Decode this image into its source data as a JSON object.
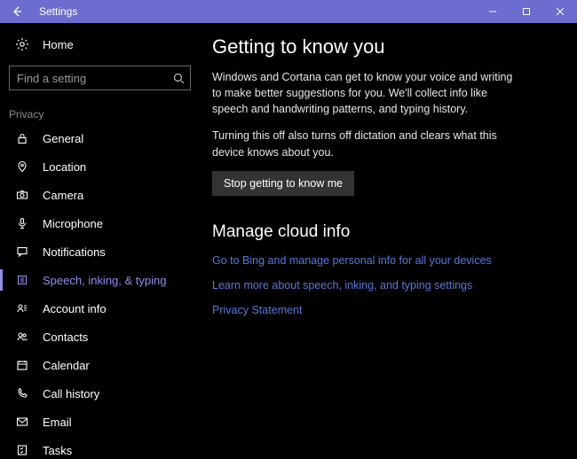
{
  "titlebar": {
    "title": "Settings"
  },
  "sidebar": {
    "home_label": "Home",
    "search_placeholder": "Find a setting",
    "section_label": "Privacy",
    "items": [
      {
        "label": "General",
        "icon": "lock-icon",
        "active": false
      },
      {
        "label": "Location",
        "icon": "location-icon",
        "active": false
      },
      {
        "label": "Camera",
        "icon": "camera-icon",
        "active": false
      },
      {
        "label": "Microphone",
        "icon": "microphone-icon",
        "active": false
      },
      {
        "label": "Notifications",
        "icon": "notifications-icon",
        "active": false
      },
      {
        "label": "Speech, inking, & typing",
        "icon": "speech-icon",
        "active": true
      },
      {
        "label": "Account info",
        "icon": "account-info-icon",
        "active": false
      },
      {
        "label": "Contacts",
        "icon": "contacts-icon",
        "active": false
      },
      {
        "label": "Calendar",
        "icon": "calendar-icon",
        "active": false
      },
      {
        "label": "Call history",
        "icon": "call-history-icon",
        "active": false
      },
      {
        "label": "Email",
        "icon": "email-icon",
        "active": false
      },
      {
        "label": "Tasks",
        "icon": "tasks-icon",
        "active": false
      }
    ]
  },
  "main": {
    "heading1": "Getting to know you",
    "para1": "Windows and Cortana can get to know your voice and writing to make better suggestions for you. We'll collect info like speech and handwriting patterns, and typing history.",
    "para2": "Turning this off also turns off dictation and clears what this device knows about you.",
    "button_label": "Stop getting to know me",
    "heading2": "Manage cloud info",
    "link1": "Go to Bing and manage personal info for all your devices",
    "link2": "Learn more about speech, inking, and typing settings",
    "link3": "Privacy Statement"
  }
}
